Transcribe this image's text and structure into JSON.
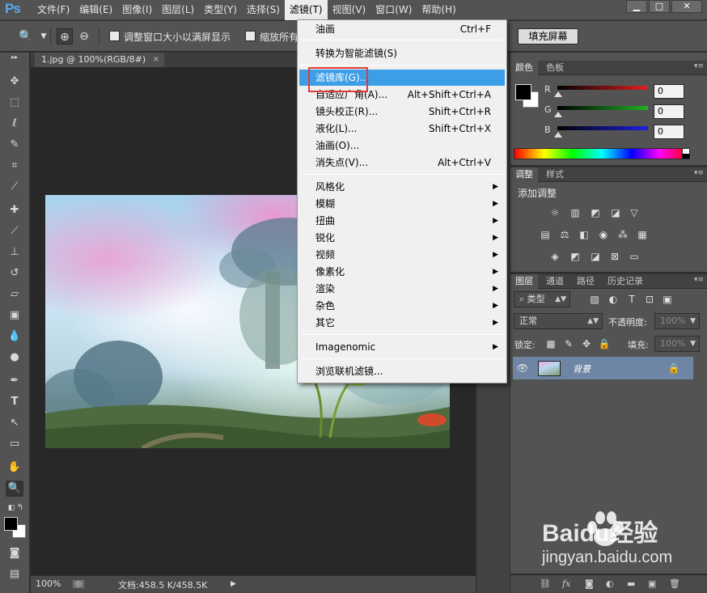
{
  "app": {
    "logo": "Ps"
  },
  "menubar": {
    "items": [
      "文件(F)",
      "编辑(E)",
      "图像(I)",
      "图层(L)",
      "类型(Y)",
      "选择(S)",
      "滤镜(T)",
      "视图(V)",
      "窗口(W)",
      "帮助(H)"
    ],
    "active_index": 6
  },
  "window_controls": {
    "minimize": "▁",
    "restore": "□",
    "close": "✕"
  },
  "options_bar": {
    "check_resize": "调整窗口大小以满屏显示",
    "check_zoom_all": "缩放所有",
    "fill_screen": "填充屏幕"
  },
  "document": {
    "tab_title": "1.jpg @ 100%(RGB/8#)",
    "tab_close": "×",
    "zoom": "100%",
    "doc_size": "文档:458.5 K/458.5K"
  },
  "filter_menu": {
    "items": [
      {
        "label": "油画",
        "shortcut": "Ctrl+F"
      },
      {
        "label": "转换为智能滤镜(S)",
        "shortcut": ""
      },
      {
        "label": "滤镜库(G)...",
        "shortcut": "",
        "highlight": true
      },
      {
        "label": "自适应广角(A)...",
        "shortcut": "Alt+Shift+Ctrl+A"
      },
      {
        "label": "镜头校正(R)...",
        "shortcut": "Shift+Ctrl+R"
      },
      {
        "label": "液化(L)...",
        "shortcut": "Shift+Ctrl+X"
      },
      {
        "label": "油画(O)...",
        "shortcut": ""
      },
      {
        "label": "消失点(V)...",
        "shortcut": "Alt+Ctrl+V"
      },
      {
        "label": "风格化",
        "submenu": true
      },
      {
        "label": "模糊",
        "submenu": true
      },
      {
        "label": "扭曲",
        "submenu": true
      },
      {
        "label": "锐化",
        "submenu": true
      },
      {
        "label": "视频",
        "submenu": true
      },
      {
        "label": "像素化",
        "submenu": true
      },
      {
        "label": "渲染",
        "submenu": true
      },
      {
        "label": "杂色",
        "submenu": true
      },
      {
        "label": "其它",
        "submenu": true
      },
      {
        "label": "Imagenomic",
        "submenu": true
      },
      {
        "label": "浏览联机滤镜...",
        "shortcut": ""
      }
    ]
  },
  "color_panel": {
    "tabs": [
      "颜色",
      "色板"
    ],
    "r_label": "R",
    "g_label": "G",
    "b_label": "B",
    "r": "0",
    "g": "0",
    "b": "0",
    "r_color": "#e02020",
    "g_color": "#20b020",
    "b_color": "#2020e0"
  },
  "adjustments_panel": {
    "tabs": [
      "调整",
      "样式"
    ],
    "title": "添加调整"
  },
  "layers_panel": {
    "tabs": [
      "图层",
      "通道",
      "路径",
      "历史记录"
    ],
    "kind_filter": "类型",
    "blend_mode": "正常",
    "opacity_label": "不透明度:",
    "opacity_value": "100%",
    "lock_label": "锁定:",
    "fill_label": "填充:",
    "fill_value": "100%",
    "layers": [
      {
        "name": "背景",
        "locked": true,
        "visible": true
      }
    ]
  },
  "watermark": {
    "brand": "Baidu经验",
    "url": "jingyan.baidu.com"
  }
}
